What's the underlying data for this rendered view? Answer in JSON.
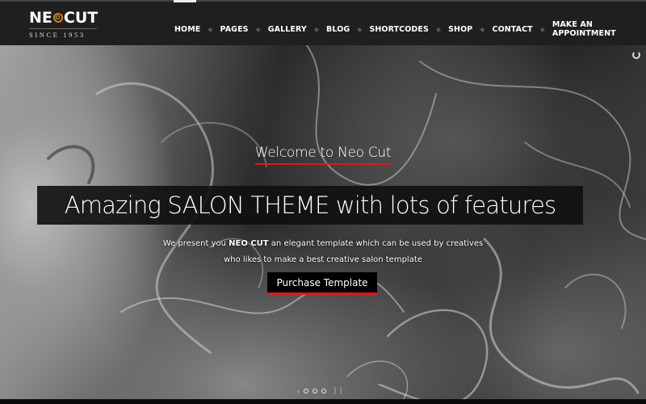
{
  "logo": {
    "text_left": "NE",
    "text_right": "CUT",
    "tagline": "SINCE 1953",
    "ring_colors": {
      "outer": "#e8731c",
      "inner": "#a6c43a"
    }
  },
  "nav": {
    "items": [
      {
        "label": "HOME",
        "active": true
      },
      {
        "label": "PAGES"
      },
      {
        "label": "GALLERY"
      },
      {
        "label": "BLOG"
      },
      {
        "label": "SHORTCODES"
      },
      {
        "label": "SHOP"
      },
      {
        "label": "CONTACT"
      },
      {
        "label": "MAKE AN APPOINTMENT"
      }
    ],
    "separator": "◆"
  },
  "hero": {
    "welcome": "Welcome to Neo Cut",
    "headline": "Amazing SALON THEME with lots of features",
    "description_line1_pre": "We present you ",
    "description_line1_bold": "NEO CUT",
    "description_line1_post": " an elegant template which can be used by creatives",
    "description_line2": "who likes to make a best creative salon template",
    "cta_label": "Purchase Template",
    "accent_color": "#d9191c"
  },
  "slider": {
    "prev_arrow": "‹",
    "slide_count": 3,
    "pause_icon": "❙❙"
  }
}
